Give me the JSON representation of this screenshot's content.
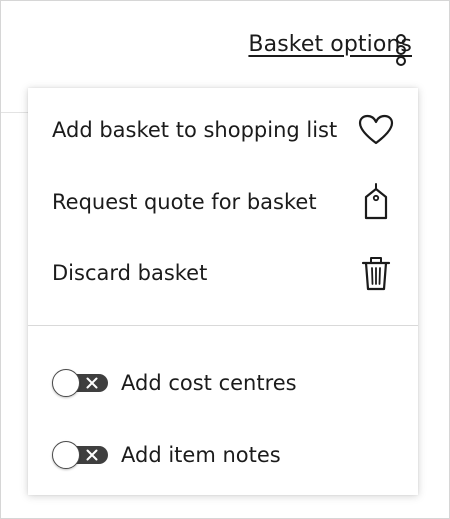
{
  "header": {
    "basket_options_label": "Basket options",
    "more_icon": "vertical-ellipsis"
  },
  "menu": {
    "items": [
      {
        "label": "Add basket to shopping list",
        "icon": "heart-icon"
      },
      {
        "label": "Request quote for basket",
        "icon": "tag-icon"
      },
      {
        "label": "Discard basket",
        "icon": "trash-icon"
      }
    ],
    "toggles": [
      {
        "label": "Add cost centres",
        "checked": false
      },
      {
        "label": "Add item notes",
        "checked": false
      }
    ]
  },
  "colors": {
    "text": "#1b1b1b",
    "toggle_track": "#3f3f3f",
    "divider": "#d9d9d9",
    "background": "#ffffff"
  }
}
